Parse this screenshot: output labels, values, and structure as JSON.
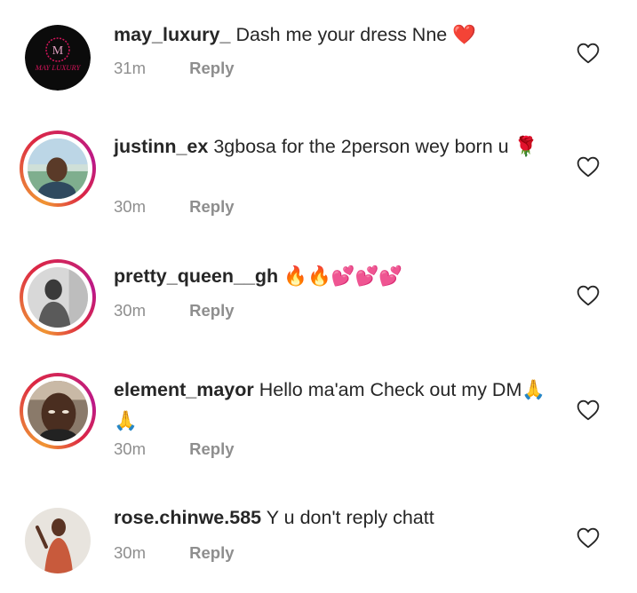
{
  "comments": [
    {
      "username": "may_luxury_",
      "text": "Dash me your dress Nne",
      "emoji": "❤️",
      "time": "31m",
      "reply": "Reply",
      "avatar_brand_text": "MAY LUXURY",
      "avatar_brand_letter": "M"
    },
    {
      "username": "justinn_ex",
      "text": "3gbosa for the 2person wey born u",
      "emoji": "🌹",
      "time": "30m",
      "reply": "Reply"
    },
    {
      "username": "pretty_queen__gh",
      "text": "",
      "emoji": "🔥🔥💕💕💕",
      "time": "30m",
      "reply": "Reply"
    },
    {
      "username": "element_mayor",
      "text": "Hello ma'am Check out my DM",
      "emoji": "🙏🙏",
      "time": "30m",
      "reply": "Reply"
    },
    {
      "username": "rose.chinwe.585",
      "text": "Y u don't reply chatt",
      "emoji": "",
      "time": "30m",
      "reply": "Reply"
    }
  ],
  "colors": {
    "text": "#262626",
    "meta": "#8e8e8e",
    "story_ring": [
      "#f09433",
      "#dc2743",
      "#bc1888"
    ],
    "brand_red": "#d4145a"
  },
  "icons": {
    "like": "heart-outline-icon"
  }
}
